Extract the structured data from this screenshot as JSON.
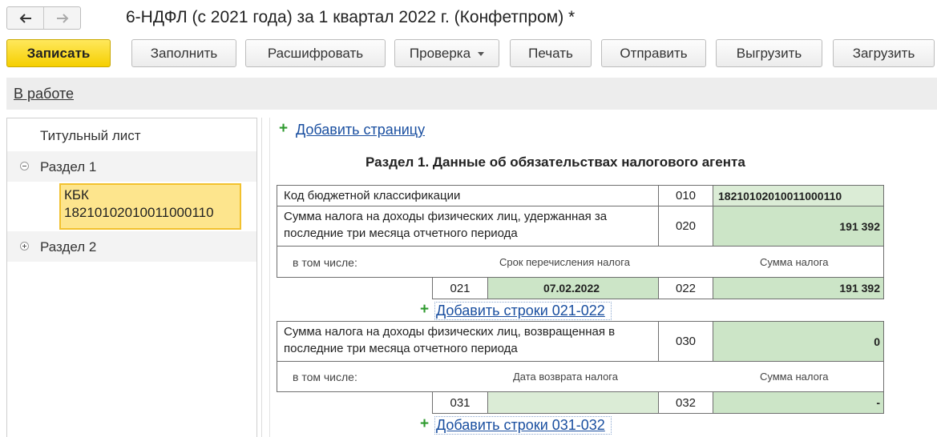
{
  "window": {
    "title": "6-НДФЛ (с 2021 года) за 1 квартал 2022 г. (Конфетпром) *",
    "nav_back_icon": "arrow-left-icon",
    "nav_forward_icon": "arrow-right-icon"
  },
  "toolbar": {
    "save": "Записать",
    "fill": "Заполнить",
    "decode": "Расшифровать",
    "check": "Проверка",
    "print": "Печать",
    "send": "Отправить",
    "export": "Выгрузить",
    "import": "Загрузить"
  },
  "status": {
    "link": "В работе"
  },
  "sidebar": {
    "items": [
      {
        "label": "Титульный лист"
      },
      {
        "label": "Раздел 1",
        "expanded": true
      },
      {
        "label": "КБК\n18210102010011000110",
        "selected": true
      },
      {
        "label": "Раздел 2",
        "expanded": false
      }
    ]
  },
  "main": {
    "add_page": "Добавить страницу",
    "section_title": "Раздел 1. Данные об обязательствах налогового агента",
    "kbk_label": "Код бюджетной классификации",
    "code_010": "010",
    "kbk_value": "18210102010011000110",
    "withheld_label": "Сумма налога на доходы физических лиц, удержанная за последние три месяца отчетного периода",
    "code_020": "020",
    "withheld_value": "191 392",
    "including_1": "в том числе:",
    "transfer_deadline_header": "Срок перечисления налога",
    "tax_amount_header_1": "Сумма налога",
    "code_021": "021",
    "date_021": "07.02.2022",
    "code_022": "022",
    "amount_022": "191 392",
    "add_rows_021": "Добавить строки 021-022",
    "returned_label": "Сумма налога на доходы физических лиц, возвращенная в последние три месяца отчетного периода",
    "code_030": "030",
    "returned_value": "0",
    "including_2": "в том числе:",
    "return_date_header": "Дата возврата налога",
    "tax_amount_header_2": "Сумма налога",
    "code_031": "031",
    "date_031": "",
    "code_032": "032",
    "amount_032": "-",
    "add_rows_031": "Добавить строки 031-032"
  },
  "colors": {
    "primary_button": "#f5cf00",
    "value_cell": "#cce5c7",
    "link": "#1a4fa0",
    "plus": "#2e9a2e",
    "selected_tree_item": "#fde58d"
  }
}
